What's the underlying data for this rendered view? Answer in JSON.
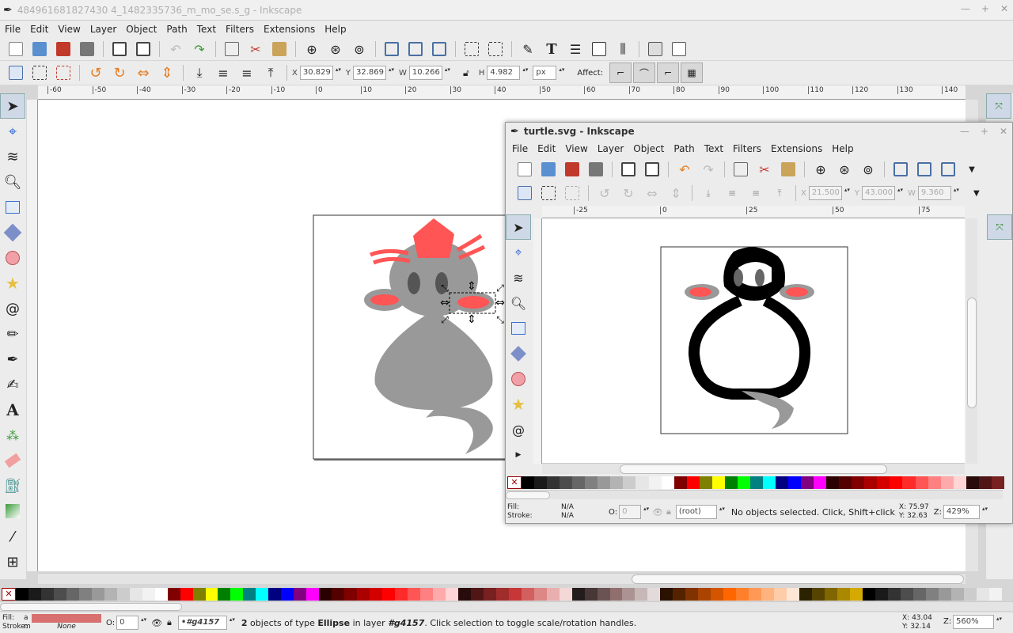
{
  "main": {
    "title": "484961681827430 4_1482335736_m_mo_se.s_g - Inkscape",
    "menu": [
      "File",
      "Edit",
      "View",
      "Layer",
      "Object",
      "Path",
      "Text",
      "Filters",
      "Extensions",
      "Help"
    ],
    "x_label": "X",
    "x_value": "30.829",
    "y_label": "Y",
    "y_value": "32.869",
    "w_label": "W",
    "w_value": "10.266",
    "h_label": "H",
    "h_value": "4.982",
    "unit": "px",
    "affect_label": "Affect:",
    "ruler_ticks": [
      "-60",
      "-50",
      "-40",
      "-30",
      "-20",
      "-10",
      "0",
      "10",
      "20",
      "30",
      "40",
      "50",
      "60",
      "70",
      "80",
      "90",
      "100",
      "110",
      "120",
      "130",
      "140"
    ],
    "status": {
      "fill_label": "Fill:",
      "fill_value": "a",
      "stroke_label": "Stroke:",
      "stroke_value": "m",
      "stroke_none": "None",
      "fill_color": "#d97070",
      "opacity_label": "O:",
      "opacity_value": "0",
      "layer_value": "•#g4157",
      "count": "2",
      "msg_a": " objects of type ",
      "type": "Ellipse",
      "msg_b": " in layer ",
      "layer": "#g4157",
      "msg_c": ". Click selection to toggle scale/rotation handles.",
      "cx_label": "X:",
      "cx_value": "43.04",
      "cy_label": "Y:",
      "cy_value": "32.14",
      "zoom_label": "Z:",
      "zoom_value": "560%"
    }
  },
  "second": {
    "title": "turtle.svg - Inkscape",
    "menu": [
      "File",
      "Edit",
      "View",
      "Layer",
      "Object",
      "Path",
      "Text",
      "Filters",
      "Extensions",
      "Help"
    ],
    "x_label": "X",
    "x_value": "21.500",
    "y_label": "Y",
    "y_value": "43.000",
    "w_label": "W",
    "w_value": "9.360",
    "ruler_ticks": [
      "-25",
      "0",
      "25",
      "50",
      "75"
    ],
    "status": {
      "fill_label": "Fill:",
      "fill_value": "N/A",
      "stroke_label": "Stroke:",
      "stroke_value": "N/A",
      "opacity_label": "O:",
      "opacity_value": "0",
      "layer_value": "(root)",
      "msg": "No objects selected. Click, Shift+click, or dr",
      "cx_label": "X:",
      "cx_value": "75.97",
      "cy_label": "Y:",
      "cy_value": "32.63",
      "zoom_label": "Z:",
      "zoom_value": "429%"
    }
  },
  "colors": {
    "accent_red": "#ff5555",
    "body_gray": "#999999",
    "black": "#000000"
  }
}
